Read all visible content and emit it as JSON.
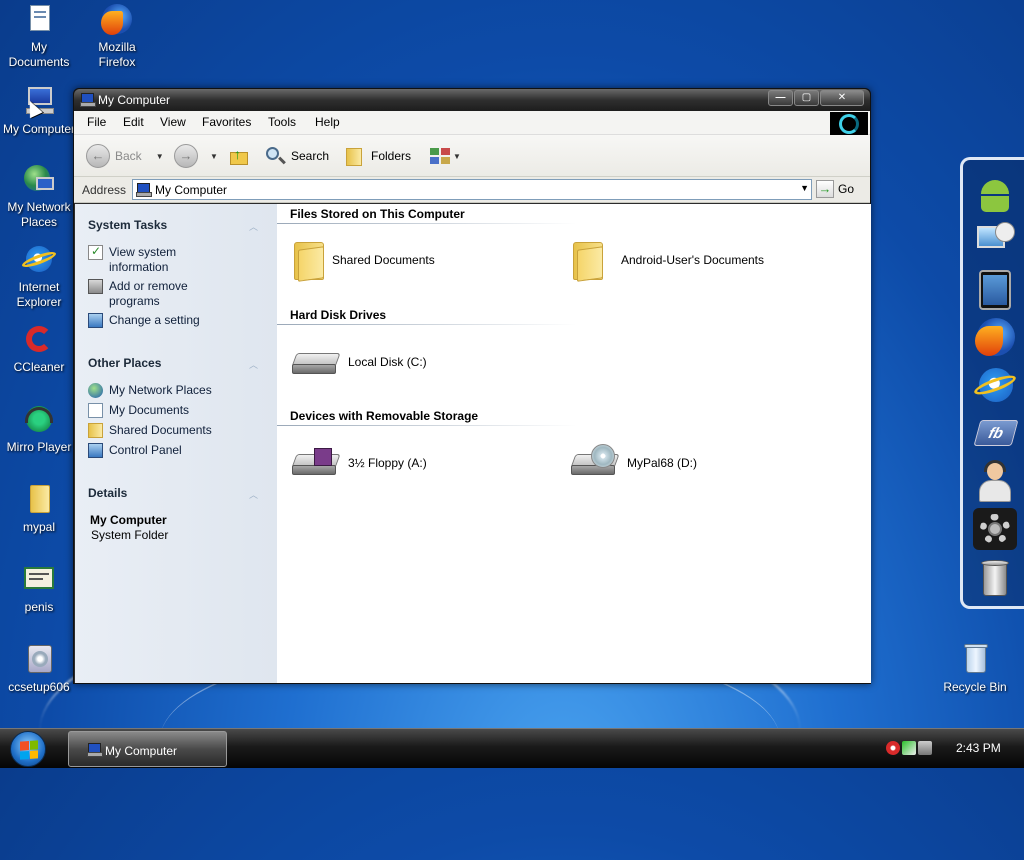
{
  "desktop": {
    "icons": [
      {
        "label": "My\nDocuments"
      },
      {
        "label": "Mozilla\nFirefox"
      },
      {
        "label": "My Computer"
      },
      {
        "label": "My Network\nPlaces"
      },
      {
        "label": "Internet\nExplorer"
      },
      {
        "label": "CCleaner"
      },
      {
        "label": "Mirro Player"
      },
      {
        "label": "mypal"
      },
      {
        "label": "penis"
      },
      {
        "label": "ccsetup606"
      },
      {
        "label": "Recycle Bin"
      }
    ]
  },
  "window": {
    "title": "My Computer",
    "controls": {
      "minimize": "—",
      "maximize": "▢",
      "close": "✕"
    },
    "menu": [
      "File",
      "Edit",
      "View",
      "Favorites",
      "Tools",
      "Help"
    ],
    "toolbar": {
      "back": "Back",
      "search": "Search",
      "folders": "Folders"
    },
    "address": {
      "label": "Address",
      "value": "My Computer",
      "go": "Go"
    },
    "sidebar": {
      "system_tasks": {
        "title": "System Tasks",
        "items": [
          "View system\ninformation",
          "Add or remove\nprograms",
          "Change a setting"
        ]
      },
      "other_places": {
        "title": "Other Places",
        "items": [
          "My Network Places",
          "My Documents",
          "Shared Documents",
          "Control Panel"
        ]
      },
      "details": {
        "title": "Details",
        "name": "My Computer",
        "type": "System Folder"
      }
    },
    "groups": {
      "files": {
        "title": "Files Stored on This Computer",
        "items": [
          "Shared Documents",
          "Android-User's Documents"
        ]
      },
      "drives": {
        "title": "Hard Disk Drives",
        "items": [
          "Local Disk (C:)"
        ]
      },
      "removable": {
        "title": "Devices with Removable Storage",
        "items": [
          "3½ Floppy (A:)",
          "MyPal68 (D:)"
        ]
      }
    }
  },
  "taskbar": {
    "active_window": "My Computer",
    "clock": "2:43 PM"
  },
  "dock": {
    "icons": [
      "android-icon",
      "monitor-satellite-icon",
      "tablet-icon",
      "firefox-icon",
      "internet-explorer-icon",
      "facebook-icon",
      "support-person-icon",
      "settings-gear-icon",
      "trash-can-icon"
    ]
  },
  "colors": {
    "desktop_blue": "#1f6fd0",
    "sidebar_bg": "#e3e9f1",
    "title_bar": "#2f2f2f"
  }
}
